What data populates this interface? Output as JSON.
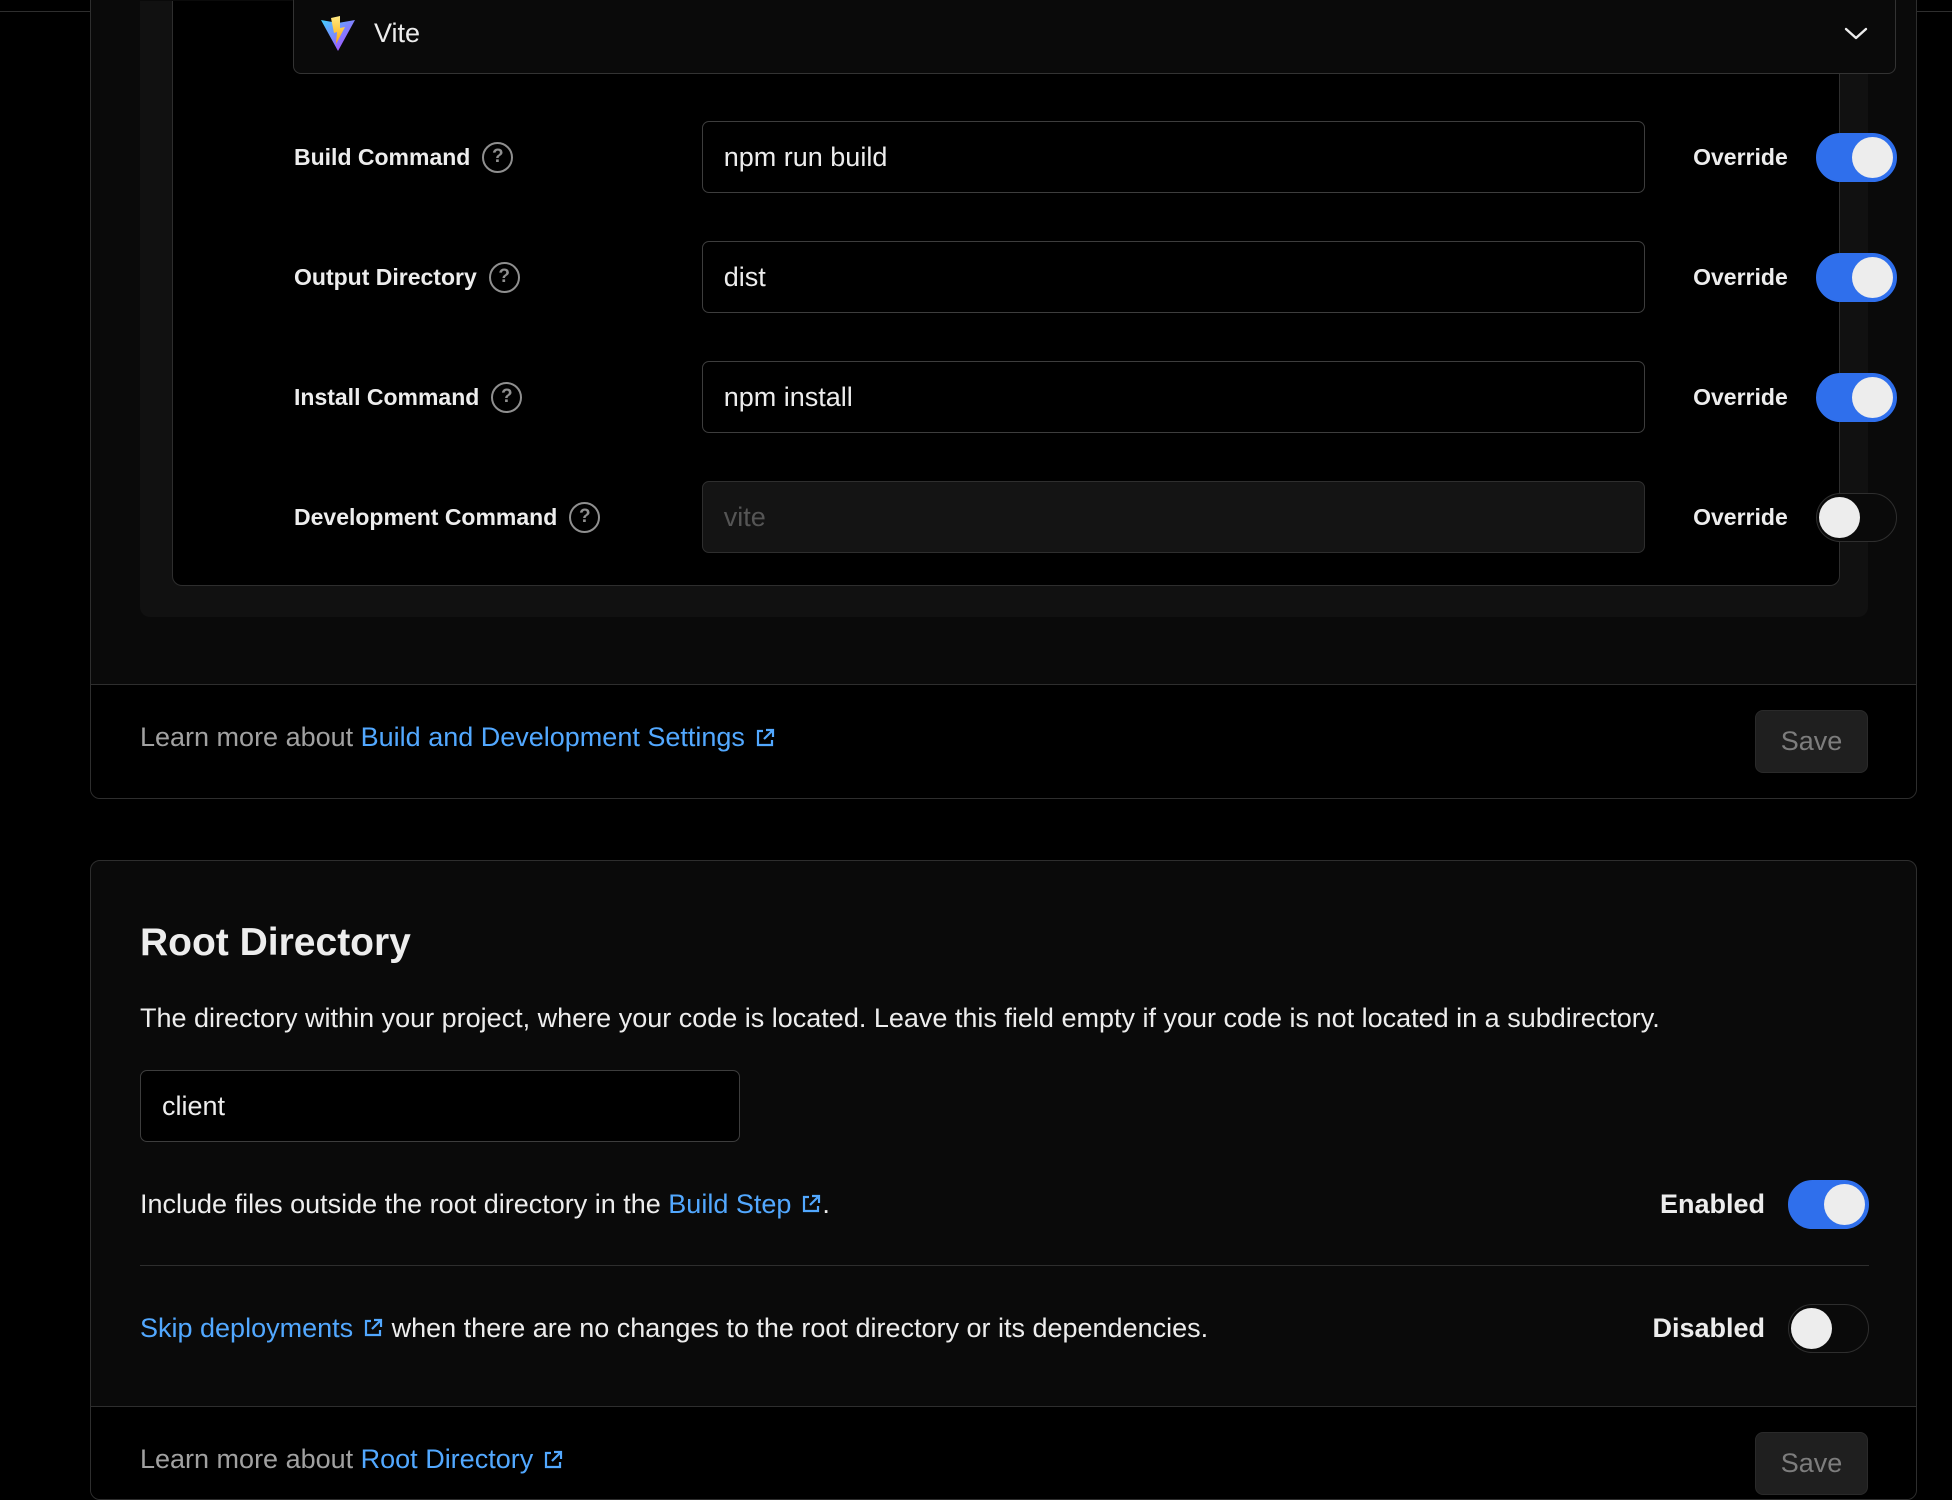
{
  "framework": {
    "name": "Vite",
    "logo_icon": "vite-logo-icon",
    "chevron_icon": "chevron-down-icon"
  },
  "build_settings": [
    {
      "label": "Build Command",
      "value": "npm run build",
      "placeholder": "",
      "override_label": "Override",
      "override": true
    },
    {
      "label": "Output Directory",
      "value": "dist",
      "placeholder": "",
      "override_label": "Override",
      "override": true
    },
    {
      "label": "Install Command",
      "value": "npm install",
      "placeholder": "",
      "override_label": "Override",
      "override": true
    },
    {
      "label": "Development Command",
      "value": "",
      "placeholder": "vite",
      "override_label": "Override",
      "override": false
    }
  ],
  "help_glyph": "?",
  "build_footer": {
    "prefix": "Learn more about ",
    "link": "Build and Development Settings",
    "save_label": "Save"
  },
  "root_directory": {
    "title": "Root Directory",
    "description": "The directory within your project, where your code is located. Leave this field empty if your code is not located in a subdirectory.",
    "value": "client",
    "include_files": {
      "prefix": "Include files outside the root directory in the ",
      "link": "Build Step",
      "suffix": ".",
      "state_label": "Enabled",
      "enabled": true
    },
    "skip_deployments": {
      "link": "Skip deployments",
      "suffix": " when there are no changes to the root directory or its dependencies.",
      "state_label": "Disabled",
      "enabled": false
    },
    "footer": {
      "prefix": "Learn more about ",
      "link": "Root Directory",
      "save_label": "Save"
    }
  },
  "colors": {
    "accent": "#2f6fec",
    "link": "#52a8ff",
    "background": "#000000"
  }
}
